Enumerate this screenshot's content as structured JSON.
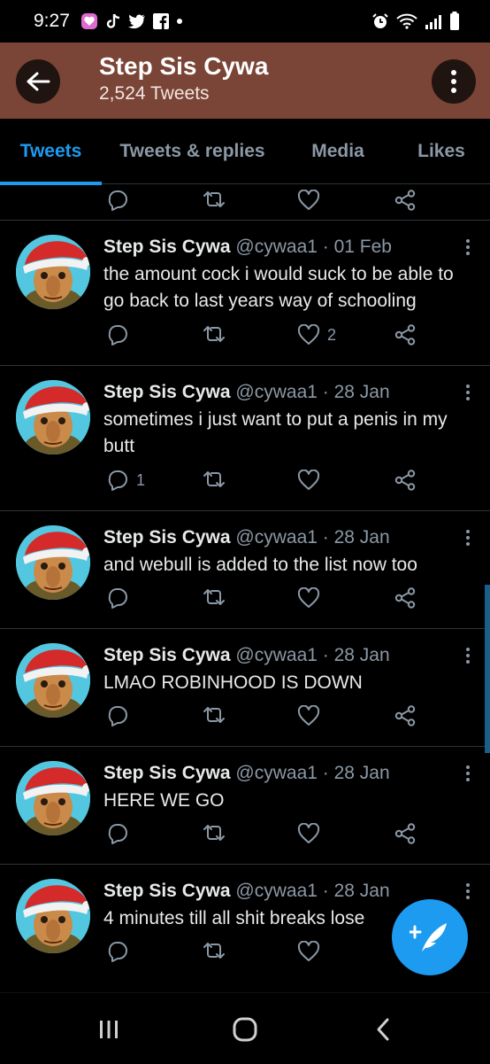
{
  "status_bar": {
    "time": "9:27"
  },
  "header": {
    "title": "Step Sis Cywa",
    "subtitle": "2,524 Tweets"
  },
  "tabs": [
    {
      "label": "Tweets",
      "active": true
    },
    {
      "label": "Tweets & replies",
      "active": false
    },
    {
      "label": "Media",
      "active": false
    },
    {
      "label": "Likes",
      "active": false
    }
  ],
  "tweets": [
    {
      "name": "Step Sis Cywa",
      "meta": "@cywaa1 · 01 Feb",
      "text": "the amount cock i would suck to be able to go back to last years way of schooling",
      "replies": "",
      "likes": "2"
    },
    {
      "name": "Step Sis Cywa",
      "meta": "@cywaa1 · 28 Jan",
      "text": "sometimes i just want to put a penis in my butt",
      "replies": "1",
      "likes": ""
    },
    {
      "name": "Step Sis Cywa",
      "meta": "@cywaa1 · 28 Jan",
      "text": "and webull is added to the list now too",
      "replies": "",
      "likes": ""
    },
    {
      "name": "Step Sis Cywa",
      "meta": "@cywaa1 · 28 Jan",
      "text": "LMAO ROBINHOOD IS DOWN",
      "replies": "",
      "likes": ""
    },
    {
      "name": "Step Sis Cywa",
      "meta": "@cywaa1 · 28 Jan",
      "text": "HERE WE GO",
      "replies": "",
      "likes": ""
    },
    {
      "name": "Step Sis Cywa",
      "meta": "@cywaa1 · 28 Jan",
      "text": "4 minutes till all shit breaks lose",
      "replies": "",
      "likes": ""
    }
  ],
  "colors": {
    "header_bg": "#7a4436",
    "accent": "#1d9bf0",
    "text_secondary": "#8b98a5"
  },
  "icons": [
    "back-arrow-icon",
    "more-vert-icon",
    "reply-icon",
    "retweet-icon",
    "like-icon",
    "share-icon",
    "compose-icon"
  ]
}
